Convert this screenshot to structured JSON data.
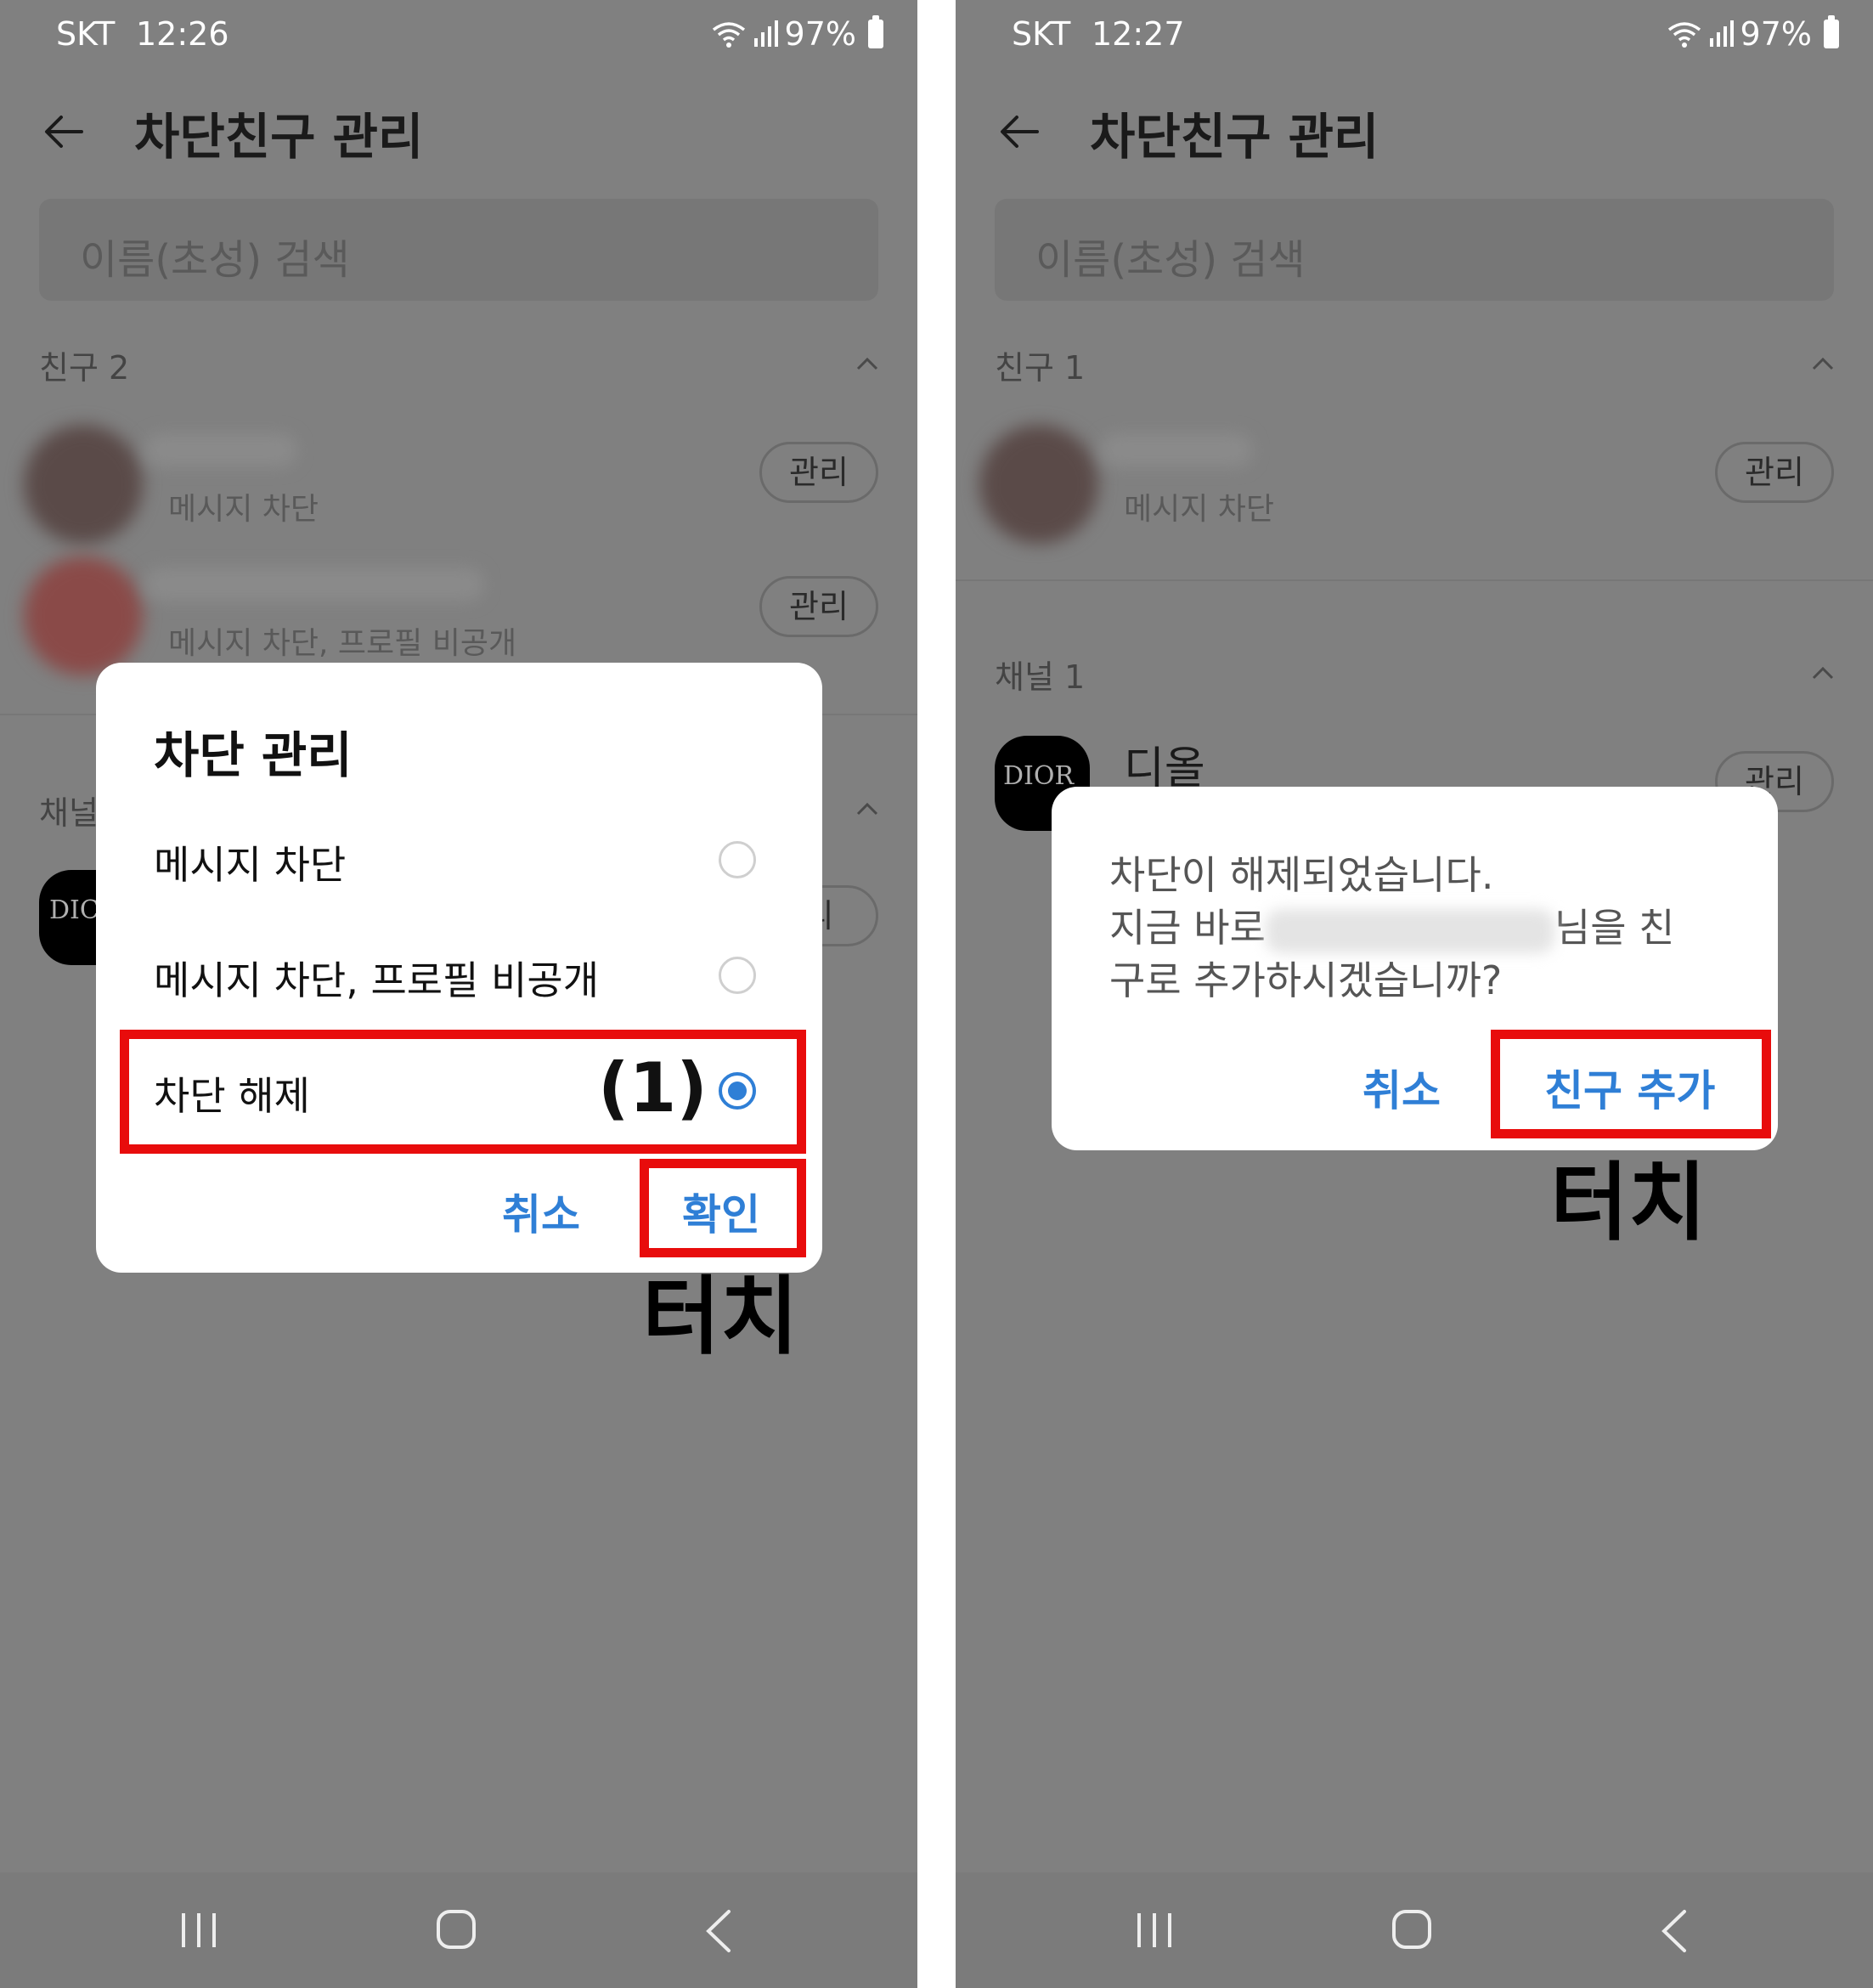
{
  "left": {
    "status": {
      "carrier": "SKT",
      "time": "12:26",
      "battery": "97%"
    },
    "title": "차단친구 관리",
    "search_placeholder": "이름(초성) 검색",
    "friends_section": "친구 2",
    "friends": [
      {
        "status": "메시지 차단",
        "manage": "관리"
      },
      {
        "status": "메시지 차단, 프로필 비공개",
        "manage": "관리"
      }
    ],
    "channel_section": "채널",
    "channel": {
      "logo": "DIC",
      "manage": "리"
    },
    "dialog": {
      "title": "차단 관리",
      "options": [
        "메시지 차단",
        "메시지 차단, 프로필 비공개",
        "차단 해제"
      ],
      "selected_index": 2,
      "cancel": "취소",
      "confirm": "확인"
    },
    "annotations": {
      "step": "(1)",
      "touch": "터치"
    }
  },
  "right": {
    "status": {
      "carrier": "SKT",
      "time": "12:27",
      "battery": "97%"
    },
    "title": "차단친구 관리",
    "search_placeholder": "이름(초성) 검색",
    "friends_section": "친구 1",
    "friends": [
      {
        "status": "메시지 차단",
        "manage": "관리"
      }
    ],
    "channel_section": "채널 1",
    "channel": {
      "logo": "DIOR",
      "name": "디올",
      "manage": "관리"
    },
    "dialog": {
      "line1": "차단이 해제되었습니다.",
      "line2_prefix": "지금 바로",
      "line2_suffix": "님을 친",
      "line3": "구로 추가하시겠습니까?",
      "cancel": "취소",
      "confirm": "친구 추가"
    },
    "annotations": {
      "touch": "터치"
    }
  },
  "colors": {
    "accent": "#2f7fd6",
    "highlight": "#e80c0c",
    "dim": "#808080"
  },
  "icons": [
    "back-arrow-icon",
    "chevron-up-icon",
    "wifi-icon",
    "signal-icon",
    "battery-icon",
    "recent-apps-icon",
    "home-icon",
    "nav-back-icon"
  ]
}
